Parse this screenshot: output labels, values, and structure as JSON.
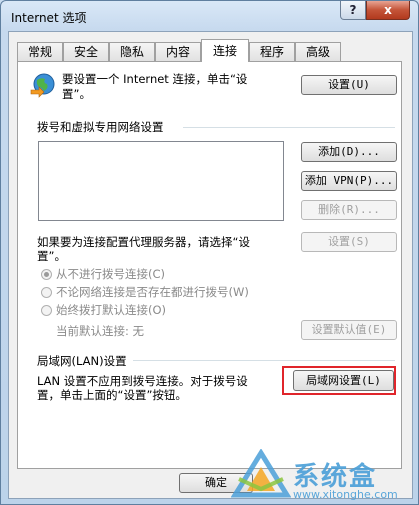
{
  "window": {
    "title": "Internet 选项",
    "help_label": "?",
    "close_label": "x"
  },
  "tabs": [
    {
      "label": "常规"
    },
    {
      "label": "安全"
    },
    {
      "label": "隐私"
    },
    {
      "label": "内容"
    },
    {
      "label": "连接",
      "active": true
    },
    {
      "label": "程序"
    },
    {
      "label": "高级"
    }
  ],
  "setup": {
    "text_line1": "要设置一个 Internet 连接，单击“设",
    "text_line2": "置”。",
    "button": "设置(U)",
    "icon": "globe-network-icon"
  },
  "dialup": {
    "heading": "拨号和虚拟专用网络设置",
    "add_button": "添加(D)...",
    "add_vpn_button": "添加 VPN(P)...",
    "remove_button": "删除(R)...",
    "proxy_line1": "如果要为连接配置代理服务器，请选择“设",
    "proxy_line2": "置”。",
    "settings_button": "设置(S)",
    "options": [
      {
        "label": "从不进行拨号连接(C)",
        "checked": true
      },
      {
        "label": "不论网络连接是否存在都进行拨号(W)",
        "checked": false
      },
      {
        "label": "始终拨打默认连接(O)",
        "checked": false
      }
    ],
    "current_default": "当前默认连接: 无",
    "set_default_button": "设置默认值(E)"
  },
  "lan": {
    "heading": "局域网(LAN)设置",
    "text_line1": "LAN 设置不应用到拨号连接。对于拨号设",
    "text_line2": "置，单击上面的“设置”按钮。",
    "button": "局域网设置(L)"
  },
  "footer": {
    "ok_button": "确定"
  },
  "watermark": {
    "name": "系统盒",
    "url": "www.xitonghe.com"
  },
  "colors": {
    "highlight": "#e0252b",
    "watermark": "#4a9fd8"
  }
}
